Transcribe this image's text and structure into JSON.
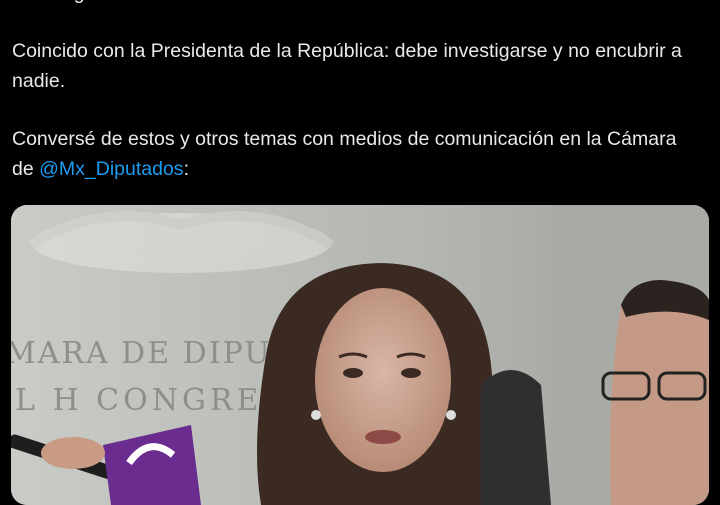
{
  "tweet": {
    "line_partial": "están ligados con el narco.",
    "paragraph_2": "Coincido con la Presidenta de la República: debe investigarse y no encubrir a nadie.",
    "paragraph_3_prefix": "Conversé de estos y otros temas con medios de comunicación en la Cámara de ",
    "mention": "@Mx_Diputados",
    "paragraph_3_suffix": ":"
  },
  "media": {
    "type": "video-thumbnail",
    "wall_text_line_1": "MARA DE DIPUTA",
    "wall_text_line_2": "L H CONGRESO"
  },
  "colors": {
    "background": "#000000",
    "text": "#e7e9ea",
    "link": "#1d9bf0",
    "mic_purple": "#6a2d8f"
  }
}
